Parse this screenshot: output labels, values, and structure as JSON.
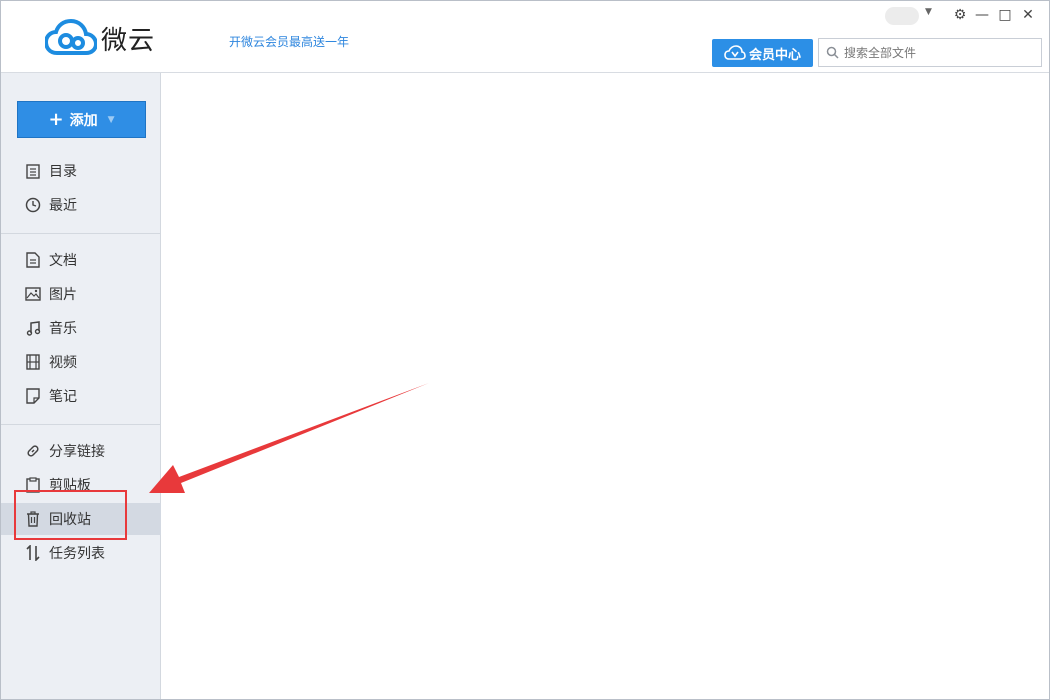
{
  "app": {
    "logo_text": "微云",
    "promo_link": "开微云会员最高送一年"
  },
  "window_controls": {
    "settings_glyph": "⚙",
    "minimize_glyph": "—",
    "maximize_glyph": "□",
    "close_glyph": "✕"
  },
  "header": {
    "vip_label": "会员中心",
    "search_placeholder": "搜索全部文件"
  },
  "sidebar": {
    "add_label": "添加",
    "items": [
      {
        "label": "目录",
        "icon": "list-icon"
      },
      {
        "label": "最近",
        "icon": "clock-icon"
      },
      {
        "label": "文档",
        "icon": "document-icon"
      },
      {
        "label": "图片",
        "icon": "image-icon"
      },
      {
        "label": "音乐",
        "icon": "music-icon"
      },
      {
        "label": "视频",
        "icon": "film-icon"
      },
      {
        "label": "笔记",
        "icon": "note-icon"
      },
      {
        "label": "分享链接",
        "icon": "link-icon"
      },
      {
        "label": "剪贴板",
        "icon": "clipboard-icon"
      },
      {
        "label": "回收站",
        "icon": "trash-icon"
      },
      {
        "label": "任务列表",
        "icon": "transfer-icon"
      }
    ],
    "active_item": "回收站"
  },
  "colors": {
    "accent": "#2f8ee5",
    "sidebar_bg": "#eceff4",
    "annotation_red": "#e8393b"
  }
}
